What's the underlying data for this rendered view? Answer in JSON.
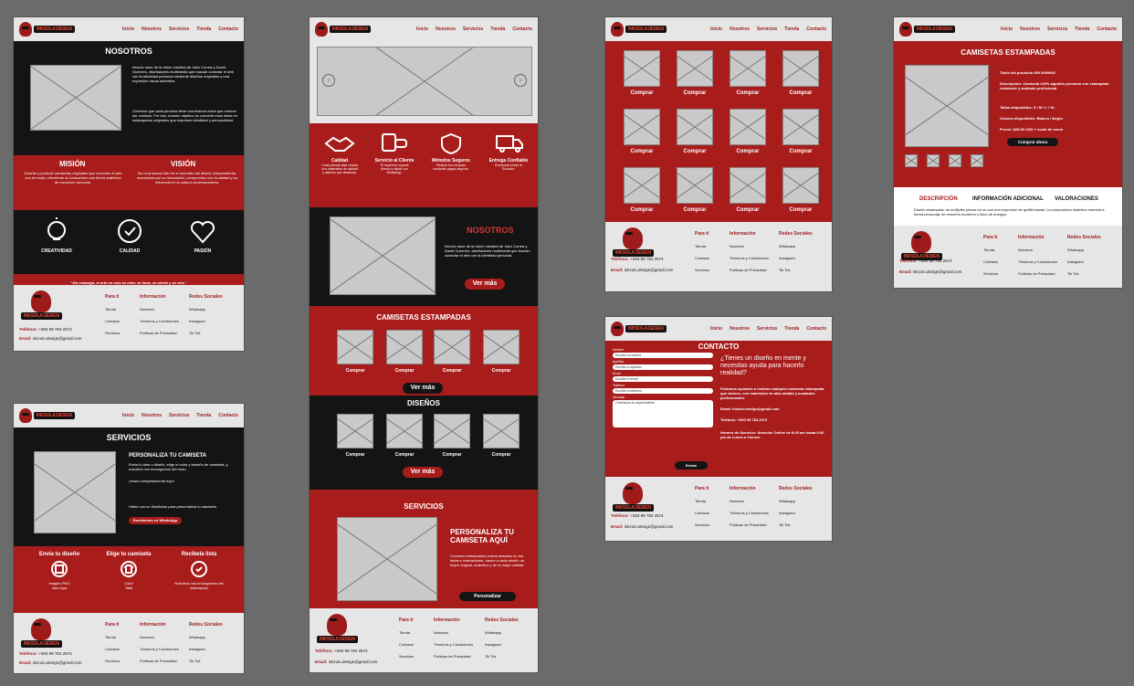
{
  "brand": {
    "wordmark": "INKSOLA DESIGN"
  },
  "nav": {
    "inicio": "Inicio",
    "nosotros": "Nosotros",
    "servicios": "Servicios",
    "tienda": "Tienda",
    "contacto": "Contacto"
  },
  "footer": {
    "col1_title": "Para ti",
    "col1_items": [
      "Tienda",
      "Contacto",
      "Servicios"
    ],
    "col2_title": "Información",
    "col2_items": [
      "Nosotros",
      "Términos y Condiciones",
      "Políticas de Privacidad"
    ],
    "col3_title": "Redes Sociales",
    "col3_items": [
      "Whatsapp",
      "Instagram",
      "Tik Tok"
    ],
    "phone_label": "Teléfono:",
    "phone": "+593 99 784 2574",
    "email_label": "Email:",
    "email": "inkzolo.design@gmail.com"
  },
  "nosotros": {
    "title": "NOSOTROS",
    "para1": "Inkzolo nace de la visión creativa de Jairo Correa y David Guerrero, diseñadores multimedia que buscan conectar el arte con la identidad personal mediante diseños originales y una expresión visual auténtica.",
    "para2": "Creemos que cada persona tiene una historia única que merece ser contada. Por eso, nuestro objetivo es convertir esas ideas en estampados originales que expresen identidad y personalidad.",
    "mision_title": "MISIÓN",
    "mision_text": "Diseñar y producir camisetas originales que conecten el arte con la moda, ofreciendo al consumidor una forma auténtica de expresión personal.",
    "vision_title": "VISIÓN",
    "vision_text": "Ser una marca líder en el mercado del diseño independiente, reconocida por su innovación, compromiso con la calidad y su influencia en la cultura contemporánea.",
    "values": [
      "CREATIVIDAD",
      "CALIDAD",
      "PASIÓN"
    ],
    "quote": "\"Sin embargo, el arte no solo se mira: se lleva, se siente y se vive.\""
  },
  "servicios_page": {
    "title": "SERVICIOS",
    "headline": "PERSONALIZA TU CAMISETA",
    "text": "Envía tu idea o diseño, elige el color y tamaño de camiseta, y nosotros nos encargamos del resto.",
    "sub": "¡Hazlo completamente tuyo!",
    "contact_text": "Habla con un diseñador para personalizar tu camiseta",
    "whatsapp_btn": "Escríbenos en WhatsApp",
    "steps": [
      {
        "title": "Envía tu diseño",
        "sub": "Imagen PNG\nIdea tuya"
      },
      {
        "title": "Elige tu camiseta",
        "sub": "Color\nTalla"
      },
      {
        "title": "Recíbela lista",
        "sub": "Nosotros nos encargamos del estampado"
      }
    ]
  },
  "home": {
    "features": [
      {
        "title": "Calidad",
        "text": "Cada prenda está creada con materiales de calidad y diseños que destacan."
      },
      {
        "title": "Servicio al Cliente",
        "text": "Te hacemos soporte directo y rápido por WhatsApp."
      },
      {
        "title": "Métodos Seguros",
        "text": "Realiza tus compras mediante pagos seguros."
      },
      {
        "title": "Entrega Confiable",
        "text": "Enviamos a todo el Ecuador."
      }
    ],
    "nosotros_title": "NOSOTROS",
    "nosotros_text": "Inkzolo nace de la visión creativa de Jairo Correa y David Guerrero, diseñadores multimedia que buscan conectar el arte con la identidad personal.",
    "ver_mas": "Ver más",
    "camisetas_title": "CAMISETAS ESTAMPADAS",
    "disenos_title": "DISEÑOS",
    "comprar": "Comprar",
    "servicios_title": "SERVICIOS",
    "servicios_headline": "PERSONALIZA TU CAMISETA AQUÍ",
    "servicios_text": "Creamos estampados únicos basados en tus ideas e ilustraciones, dando a cada diseño un toque original, auténtico y de la mejor calidad.",
    "personalizar": "Personalizar"
  },
  "tienda": {
    "comprar": "Comprar"
  },
  "contacto": {
    "title": "CONTACTO",
    "fields": [
      {
        "label": "Nombre",
        "placeholder": "Escribe tu nombre"
      },
      {
        "label": "Apellido",
        "placeholder": "Escribe tu apellido"
      },
      {
        "label": "Email",
        "placeholder": "Escribe tu email"
      },
      {
        "label": "Teléfono",
        "placeholder": "Escribe tu teléfono"
      }
    ],
    "mensaje_label": "Mensaje",
    "mensaje_placeholder": "Cuéntanos tu requerimiento",
    "enviar": "Enviar",
    "headline": "¿Tienes un diseño en mente y necesitas ayuda para hacerlo realidad?",
    "text": "Podemos ayudarte a realizar cualquier camiseta estampada que desees, con materiales de alta calidad y acabados profesionales.",
    "email": "Email: inkzolo.design@gmail.com",
    "phone": "Teléfono: +593 99 784 2574",
    "hours": "Horario de Atención: Atención Online de 8:00 am hasta 6:00 pm de Lunes a Viernes"
  },
  "producto": {
    "title": "CAMISETAS ESTAMPADAS",
    "name": "Título del producto 000 0000000",
    "desc": "Descripción: Camiseta 100% algodón premium con estampado resistente y acabado profesional.",
    "tallas": "Tallas disponibles: S / M / L / XL",
    "colores": "Colores disponibles: Blanco / Negro",
    "precio": "Precio: $25,00 USD + costo de envío",
    "btn": "Comprar ahora",
    "tabs": [
      "DESCRIPCIÓN",
      "INFORMACIÓN ADICIONAL",
      "VALORACIONES"
    ],
    "tab_text": "Diseño estampado de múltiples piezas en su con una expresión de graffiti kawaii. La composición distintiva muestra a forma personaje de ensueño moderno y lleno de energía."
  },
  "colors": {
    "red": "#a81c1c",
    "black": "#141414",
    "gray": "#e6e6e6",
    "canvas": "#6b6b6b"
  }
}
